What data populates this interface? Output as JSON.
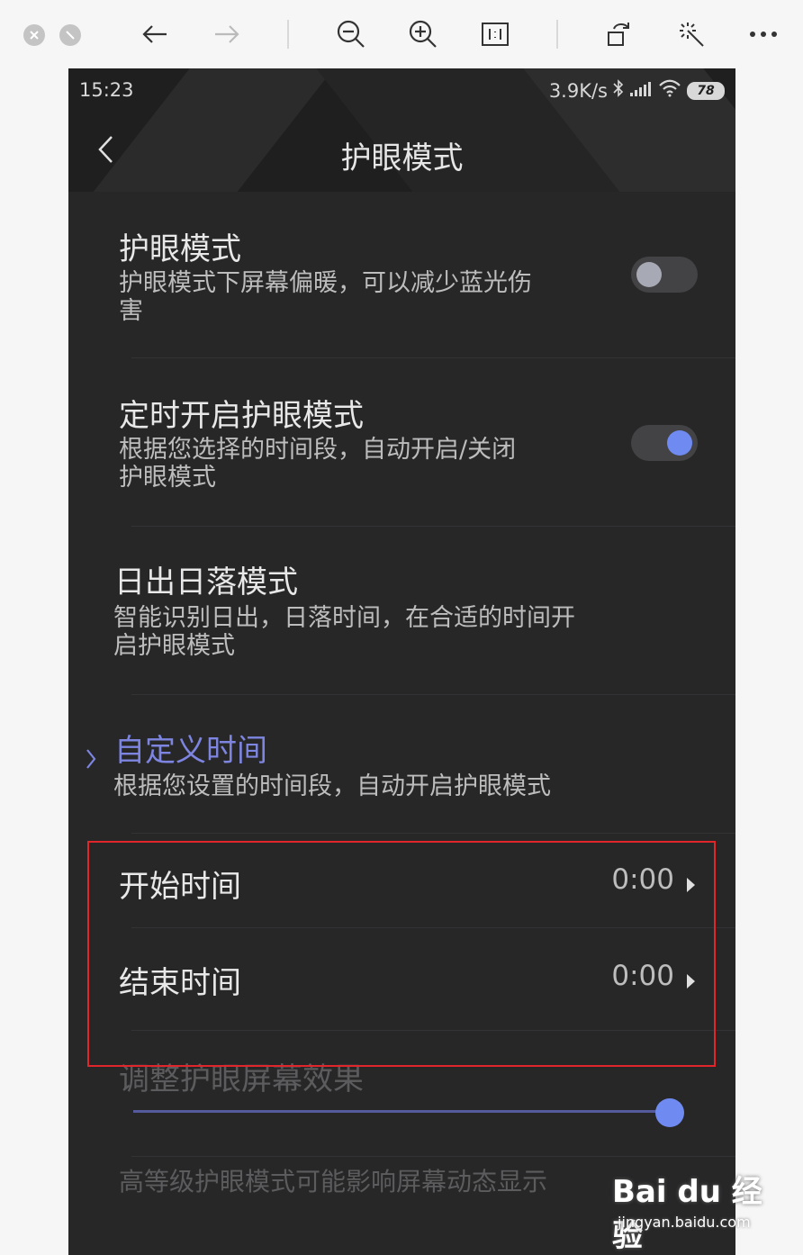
{
  "status_bar": {
    "time": "15:23",
    "net_speed": "3.9K/s",
    "battery": "78"
  },
  "header": {
    "title": "护眼模式",
    "back_icon": "chevron-left-icon"
  },
  "settings": [
    {
      "title": "护眼模式",
      "desc_line1": "护眼模式下屏幕偏暖，可以减少蓝光伤",
      "desc_line2": "害",
      "toggle": "off"
    },
    {
      "title": "定时开启护眼模式",
      "desc_line1": "根据您选择的时间段，自动开启/关闭",
      "desc_line2": "护眼模式",
      "toggle": "on"
    },
    {
      "title": "日出日落模式",
      "desc_line1": "智能识别日出，日落时间，在合适的时间开",
      "desc_line2": "启护眼模式"
    },
    {
      "title": "自定义时间",
      "desc_line1": "根据您设置的时间段，自动开启护眼模式"
    }
  ],
  "time_rows": [
    {
      "label": "开始时间",
      "value": "0:00"
    },
    {
      "label": "结束时间",
      "value": "0:00"
    }
  ],
  "effect": {
    "title": "调整护眼屏幕效果",
    "slider_level": 1.0,
    "warning": "高等级护眼模式可能影响屏幕动态显示"
  },
  "watermark": {
    "line1": "Bai du 经验",
    "line2": "jingyan.baidu.com"
  },
  "colors": {
    "accent": "#6f8af0",
    "highlight_box": "#e0262a",
    "background": "#272728"
  }
}
